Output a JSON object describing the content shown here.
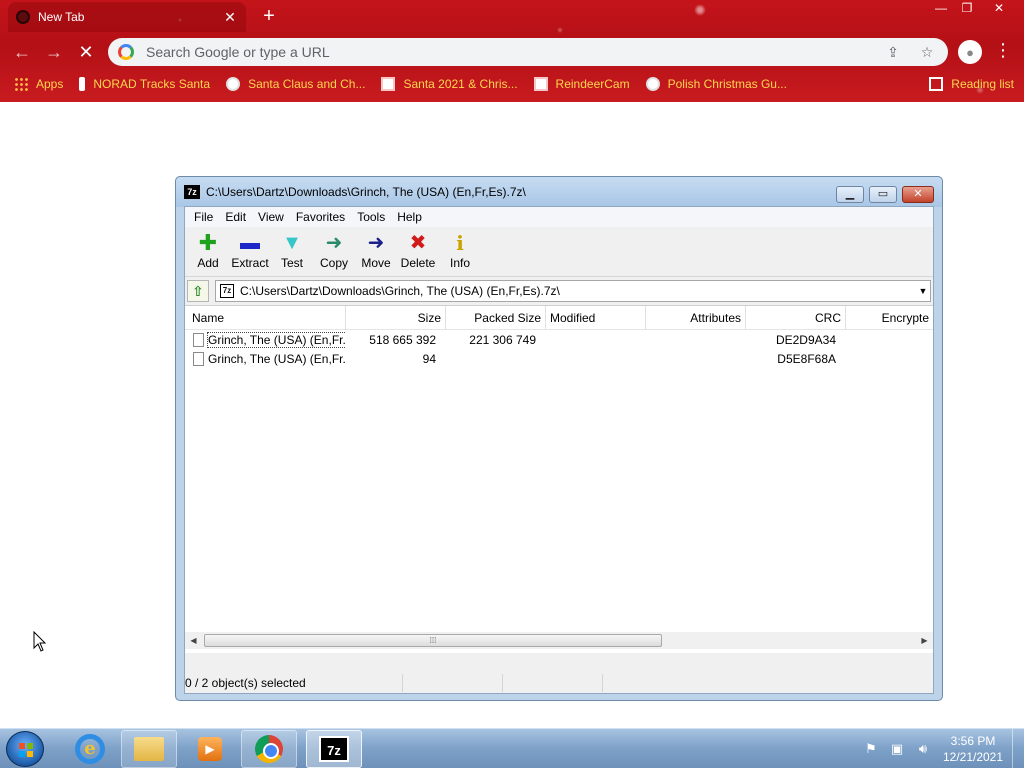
{
  "browser": {
    "tab_title": "New Tab",
    "tab_close": "✕",
    "new_tab": "+",
    "window_controls": {
      "minimize": "—",
      "maximize": "❐",
      "close": "✕"
    },
    "nav": {
      "back": "←",
      "forward": "→",
      "stop": "✕"
    },
    "omnibox_placeholder": "Search Google or type a URL",
    "bookmarks": [
      {
        "label": "Apps",
        "icon": "apps-grid-icon"
      },
      {
        "label": "NORAD Tracks Santa",
        "icon": "norad-icon"
      },
      {
        "label": "Santa Claus and Ch...",
        "icon": "globe-icon"
      },
      {
        "label": "Santa 2021 & Chris...",
        "icon": "image-icon"
      },
      {
        "label": "ReindeerCam",
        "icon": "image-icon"
      },
      {
        "label": "Polish Christmas Gu...",
        "icon": "globe-icon"
      }
    ],
    "reading_list": "Reading list"
  },
  "sevenzip": {
    "title": "C:\\Users\\Dartz\\Downloads\\Grinch, The (USA) (En,Fr,Es).7z\\",
    "logo": "7z",
    "menu": [
      "File",
      "Edit",
      "View",
      "Favorites",
      "Tools",
      "Help"
    ],
    "toolbar": [
      {
        "label": "Add",
        "icon": "add-icon",
        "glyph": "✚",
        "color": "#1fa31f"
      },
      {
        "label": "Extract",
        "icon": "extract-icon",
        "glyph": "▬",
        "color": "#1d27c9"
      },
      {
        "label": "Test",
        "icon": "test-icon",
        "glyph": "▼",
        "color": "#35c6c6"
      },
      {
        "label": "Copy",
        "icon": "copy-icon",
        "glyph": "➜",
        "color": "#2a8a6a"
      },
      {
        "label": "Move",
        "icon": "move-icon",
        "glyph": "➜",
        "color": "#1a1f8c"
      },
      {
        "label": "Delete",
        "icon": "delete-icon",
        "glyph": "✖",
        "color": "#d11a1a"
      },
      {
        "label": "Info",
        "icon": "info-icon",
        "glyph": "i",
        "color": "#c9a400"
      }
    ],
    "path": "C:\\Users\\Dartz\\Downloads\\Grinch, The (USA) (En,Fr,Es).7z\\",
    "columns": [
      "Name",
      "Size",
      "Packed Size",
      "Modified",
      "Attributes",
      "CRC",
      "Encrypte"
    ],
    "rows": [
      {
        "name": "Grinch, The (USA) (En,Fr...",
        "size": "518 665 392",
        "packed": "221 306 749",
        "modified": "",
        "attributes": "",
        "crc": "DE2D9A34",
        "encrypted": ""
      },
      {
        "name": "Grinch, The (USA) (En,Fr...",
        "size": "94",
        "packed": "",
        "modified": "",
        "attributes": "",
        "crc": "D5E8F68A",
        "encrypted": ""
      }
    ],
    "status": "0 / 2 object(s) selected"
  },
  "taskbar": {
    "clock_time": "3:56 PM",
    "clock_date": "12/21/2021"
  }
}
